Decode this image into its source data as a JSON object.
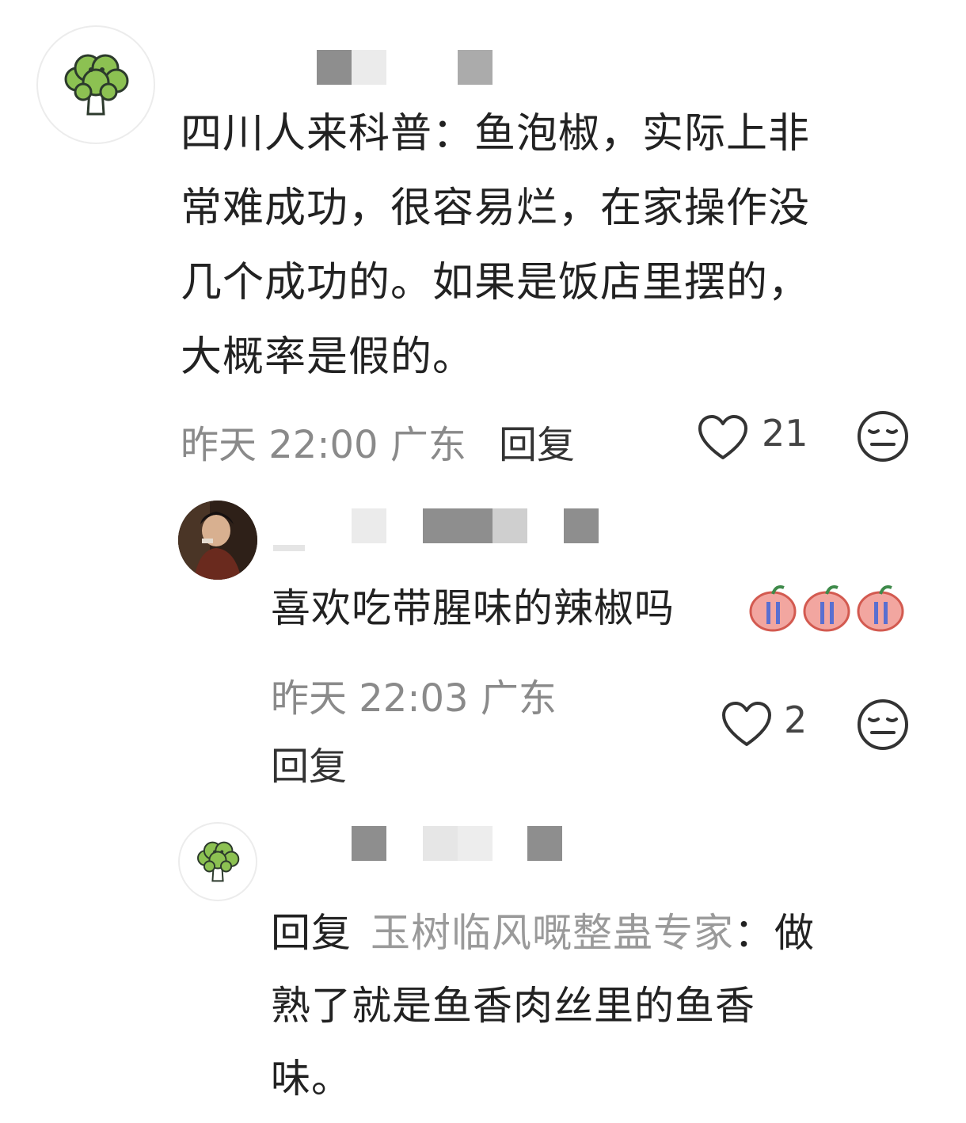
{
  "comments": [
    {
      "avatar": "broccoli-avatar",
      "text": "四川人来科普：鱼泡椒，实际上非常难成功，很容易烂，在家操作没几个成功的。如果是饭店里摆的，大概率是假的。",
      "lines": [
        "四川人来科普：鱼泡椒，实际上非",
        "常难成功，很容易烂，在家操作没",
        "几个成功的。如果是饭店里摆的，",
        "大概率是假的。"
      ],
      "time": "昨天 22:00",
      "location": "广东",
      "reply_label": "回复",
      "likes": "21"
    },
    {
      "avatar": "photo-avatar",
      "text": "喜欢吃带腥味的辣椒吗",
      "emoji": "crying-pepper-emoji",
      "time": "昨天 22:03",
      "location": "广东",
      "reply_label": "回复",
      "likes": "2"
    },
    {
      "avatar": "broccoli-avatar",
      "reply_prefix": "回复",
      "mention": "玉树临风嘅整蛊专家",
      "colon": "：",
      "lines_first": "做",
      "lines": [
        "熟了就是鱼香肉丝里的鱼香",
        "味。"
      ]
    }
  ],
  "colors": {
    "text": "#222222",
    "meta": "#8a8a8a",
    "broccoli_green": "#5a8a4a",
    "redacted": "#9a9a9a"
  }
}
